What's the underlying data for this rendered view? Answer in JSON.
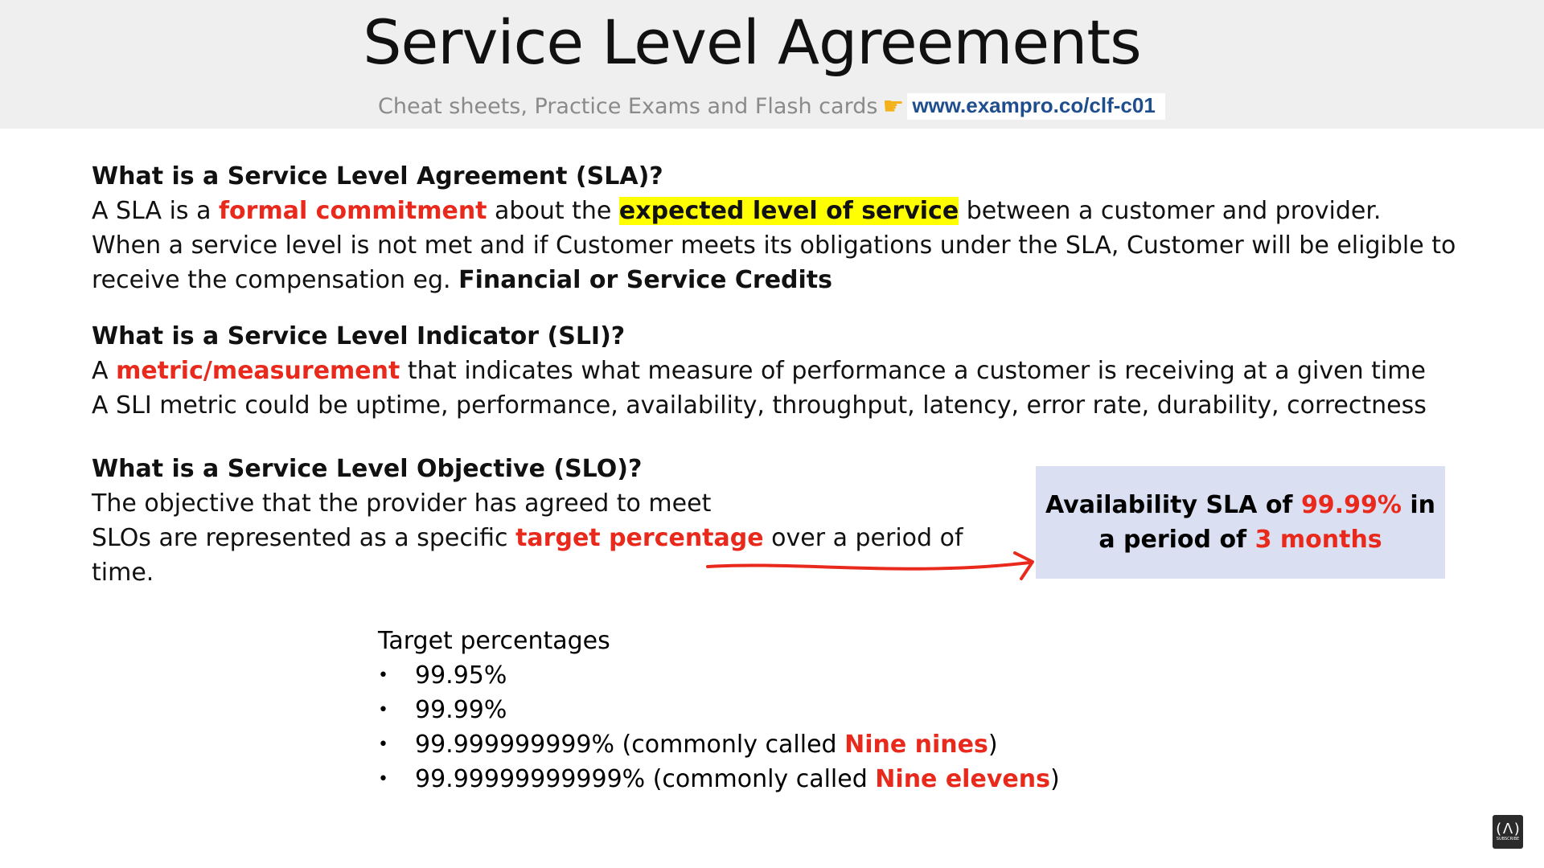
{
  "header": {
    "title": "Service Level Agreements",
    "promo_text": "Cheat sheets, Practice Exams and Flash cards",
    "promo_icon": "pointing-hand-icon",
    "promo_link": "www.exampro.co/clf-c01"
  },
  "sla": {
    "question": "What is a Service Level Agreement (SLA)?",
    "l1_a": "A SLA is a ",
    "l1_red": "formal commitment",
    "l1_b": " about the ",
    "l1_highlight": "expected level of service",
    "l1_c": " between a customer and provider.",
    "l2": "When a service level is not met and if Customer meets its obligations under the SLA, Customer will be eligible to receive the compensation eg. ",
    "l2_bold": "Financial or Service Credits"
  },
  "sli": {
    "question": "What is a Service Level Indicator (SLI)?",
    "l1_a": "A ",
    "l1_red": "metric/measurement",
    "l1_b": " that indicates what measure of performance a customer is receiving at a given time",
    "l2": "A SLI metric could be uptime, performance, availability, throughput, latency, error rate, durability, correctness"
  },
  "slo": {
    "question": "What is a Service Level Objective (SLO)?",
    "l1": "The objective that the provider has agreed to meet",
    "l2_a": "SLOs are represented as a specific ",
    "l2_red": "target percentage",
    "l2_b": " over a period of time."
  },
  "callout": {
    "a": "Availability  SLA of ",
    "red1": "99.99%",
    "b": " in a period of ",
    "red2": "3 months"
  },
  "targets": {
    "heading": "Target percentages",
    "bullet": "•",
    "item1": "99.95%",
    "item2": "99.99%",
    "item3_a": "99.999999999% (commonly called ",
    "item3_red": "Nine nines",
    "item3_b": ")",
    "item4_a": "99.99999999999% (commonly called ",
    "item4_red": "Nine elevens",
    "item4_b": ")"
  },
  "logo": {
    "glyph": "(ᐱ)",
    "text": "SUBSCRIBE"
  },
  "colors": {
    "accent_red": "#e8291c",
    "highlight": "#ffff00",
    "callout_bg": "#dae0f2",
    "link": "#1f4e8c"
  }
}
